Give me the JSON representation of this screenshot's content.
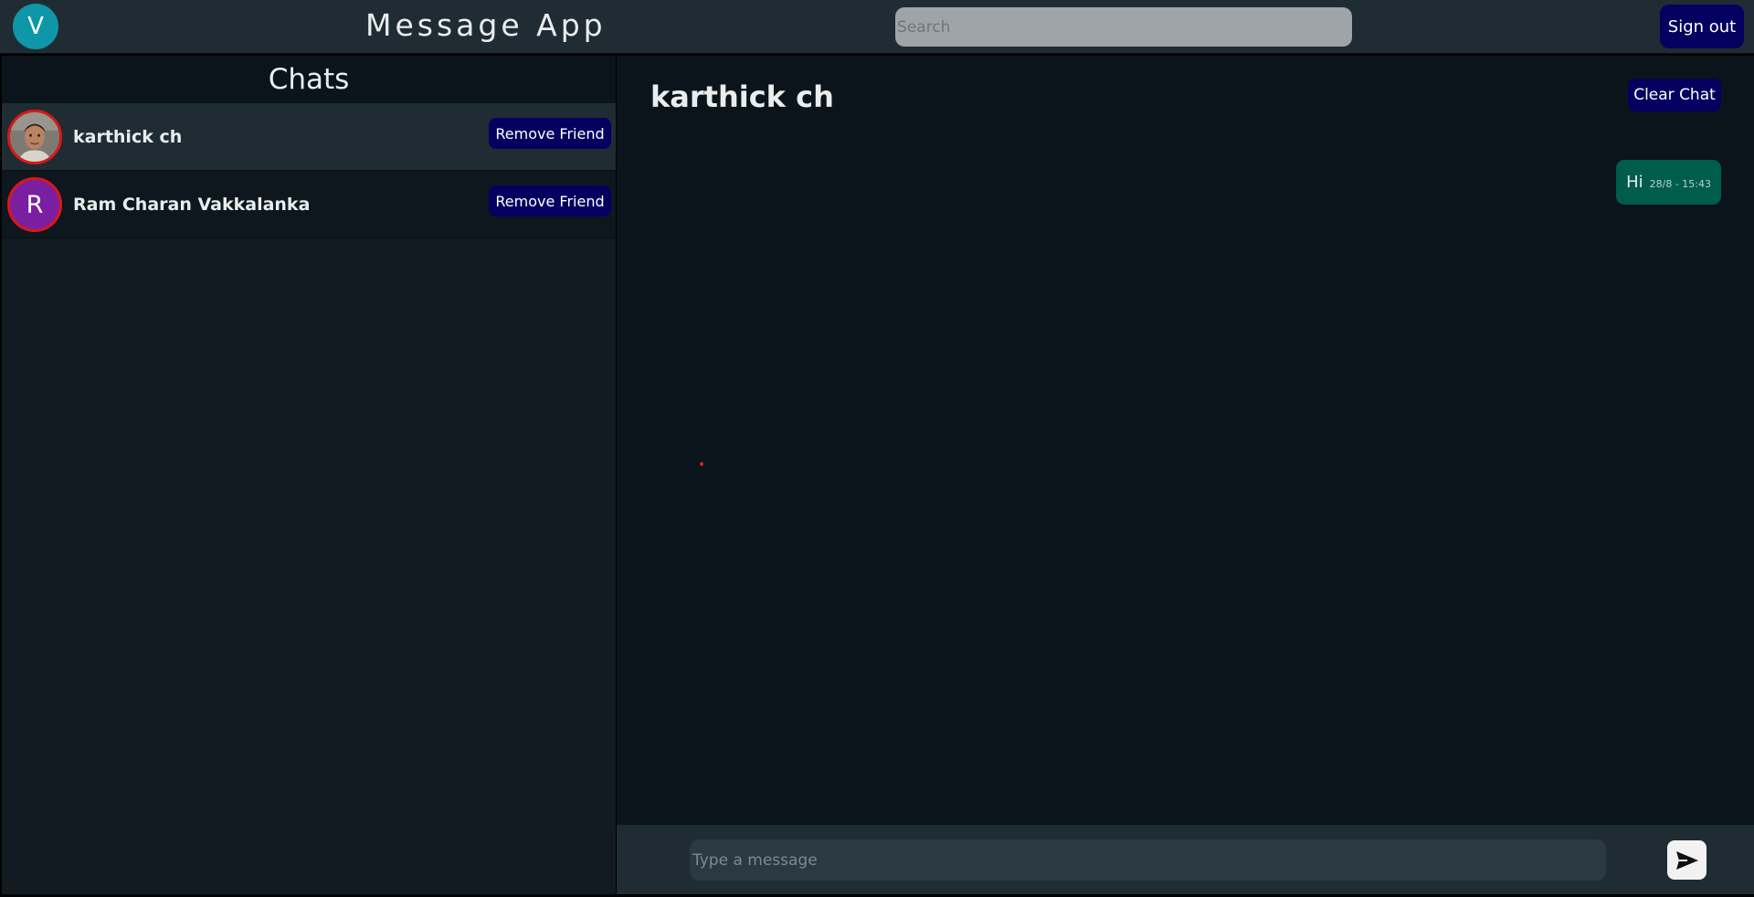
{
  "header": {
    "avatar_letter": "V",
    "app_title": "Message App",
    "search_placeholder": "Search",
    "signout_label": "Sign out"
  },
  "sidebar": {
    "title": "Chats",
    "chats": [
      {
        "name": "karthick ch",
        "avatar": "photo",
        "remove_label": "Remove Friend",
        "active": true
      },
      {
        "name": "Ram Charan Vakkalanka",
        "avatar_letter": "R",
        "remove_label": "Remove Friend",
        "active": false
      }
    ]
  },
  "conversation": {
    "title": "karthick ch",
    "clear_label": "Clear Chat",
    "messages": [
      {
        "text": "Hi",
        "time": "28/8 - 15:43",
        "outgoing": true
      }
    ],
    "composer": {
      "placeholder": "Type a message",
      "send_icon": "send-icon"
    }
  },
  "colors": {
    "topbar": "#202c33",
    "sidebar": "#111b21",
    "conversation": "#0b141a",
    "button": "#03005f",
    "bubble": "#005c4b",
    "user_avatar": "#0e97a8",
    "letter_avatar": "#7b1fa2",
    "avatar_ring": "#d81818"
  }
}
